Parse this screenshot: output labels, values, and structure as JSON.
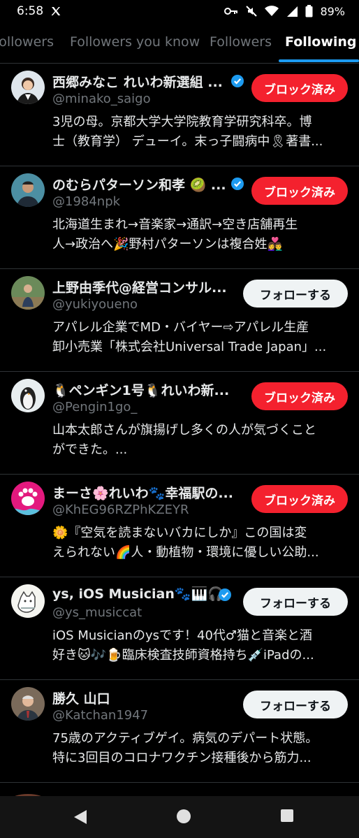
{
  "status": {
    "time": "6:58",
    "battery": "89%"
  },
  "tabs": [
    {
      "label": "Followers"
    },
    {
      "label": "Followers you know"
    },
    {
      "label": "Followers"
    },
    {
      "label": "Following"
    }
  ],
  "accounts": [
    {
      "name": "西郷みなこ れいわ新選組 ...",
      "handle": "@minako_saigo",
      "bio": "3児の母。京都大学大学院教育学研究科卒。博\n士（教育学） デューイ。末っ子闘病中🎗著書...",
      "verified": true,
      "button": "ブロック済み"
    },
    {
      "name": "のむらパターソン和孝 🥝 ...",
      "handle": "@1984npk",
      "bio": "北海道生まれ→音楽家→通訳→空き店舗再生\n人→政治へ🎉野村パターソンは複合姓👩‍❤️‍👨",
      "verified": true,
      "button": "ブロック済み"
    },
    {
      "name": "上野由季代@経営コンサル...",
      "handle": "@yukiyoueno",
      "bio": "アパレル企業でMD・バイヤー⇨アパレル生産\n卸小売業「株式会社Universal Trade Japan」...",
      "verified": false,
      "button": "フォローする"
    },
    {
      "name": "🐧ペンギン1号🐧れいわ新...",
      "handle": "@Pengin1go_",
      "bio": "山本太郎さんが旗揚げし多くの人が気づくこと\nができた。...",
      "verified": false,
      "button": "ブロック済み"
    },
    {
      "name": "まーさ🌸れいわ🐾幸福駅の...",
      "handle": "@KhEG96RZPhKZEYR",
      "bio": "🌼『空気を読まないバカにしか』この国は変\nえられない🌈人・動植物・環境に優しい公助...",
      "verified": false,
      "button": "ブロック済み"
    },
    {
      "name": "ys, iOS Musician🐾🎹🎧",
      "handle": "@ys_musiccat",
      "bio": "iOS Musicianのysです！40代♂猫と音楽と酒\n好き🐱🎶🍺臨床検査技師資格持ち💉iPadの...",
      "verified": true,
      "button": "フォローする"
    },
    {
      "name": "勝久 山口",
      "handle": "@Katchan1947",
      "bio": "75歳のアクティブゲイ。病気のデパート状態。\n特に3回目のコロナワクチン接種後から筋力...",
      "verified": false,
      "button": "フォローする"
    }
  ],
  "colors": {
    "accent": "#1d9bf0",
    "blocked": "#f4212e",
    "follow_bg": "#eff3f4",
    "muted": "#71767b"
  },
  "icons": [
    "x-logo-icon",
    "key-icon",
    "mute-icon",
    "wifi-icon",
    "signal-icon",
    "battery-icon",
    "back-icon",
    "home-icon",
    "recents-icon",
    "verified-badge-icon"
  ]
}
